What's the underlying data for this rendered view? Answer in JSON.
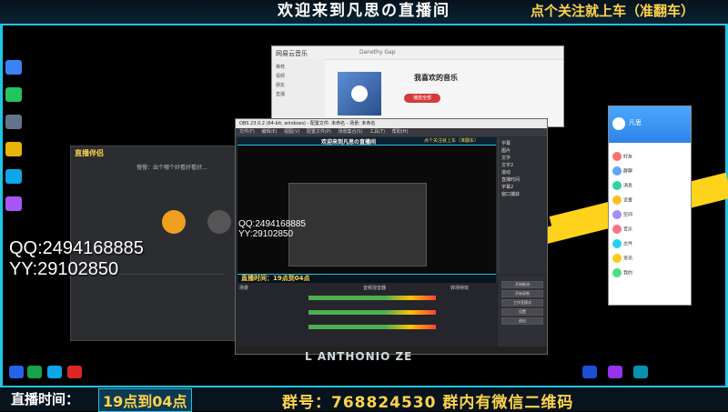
{
  "overlay": {
    "banner_title": "欢迎来到凡思の直播间",
    "banner_right": "点个关注就上车（准翻车）",
    "live_time_label": "直播时间：",
    "live_time_value": "19点到04点",
    "group_label": "群号：768824530 群内有微信二维码",
    "contact_qq": "QQ:2494168885",
    "contact_yy": "YY:29102850",
    "preview_contact_qq": "QQ:2494168885",
    "preview_contact_yy": "YY:29102850",
    "preview_live_time": "直播时间：19点到04点",
    "preview_banner_title": "欢迎来到凡思の直播间",
    "preview_banner_right": "点个关注就上车（准翻车）",
    "logo_text": "L ANTHONIO ZE",
    "accent_cyan": "#1fc4e6",
    "accent_yellow": "#ffd34a"
  },
  "live_studio": {
    "app_name": "直播伴侣",
    "notice": "慢慢：出个哪个好看好看好..."
  },
  "music": {
    "app_name": "网易云音乐",
    "search_placeholder": "Danethy Gap",
    "playlist_title": "我喜欢的音乐",
    "play_button": "播放全部",
    "sidebar": [
      "推荐",
      "视频",
      "朋友",
      "直播"
    ]
  },
  "obs": {
    "title": "OBS 23.0.2 (64-bit, windows) - 配置文件: 未命名 - 场景: 未命名",
    "menu": [
      "文件(F)",
      "编辑(E)",
      "视图(V)",
      "配置文件(P)",
      "场景集合(S)",
      "工具(T)",
      "帮助(H)"
    ],
    "sources": [
      "字幕",
      "图片",
      "文字",
      "文字2",
      "滚动",
      "直播时间",
      "字幕2",
      "窗口捕获"
    ],
    "controls": [
      "开始推流",
      "开始录制",
      "工作室模式",
      "设置",
      "退出"
    ],
    "mixer_label": "音频混音器",
    "scenes_label": "场景",
    "transitions_label": "转场特效"
  },
  "chat": {
    "title": "凡思",
    "items": [
      "好友",
      "群聊",
      "消息",
      "设置",
      "空间",
      "音乐",
      "文件",
      "资讯",
      "我的"
    ]
  }
}
